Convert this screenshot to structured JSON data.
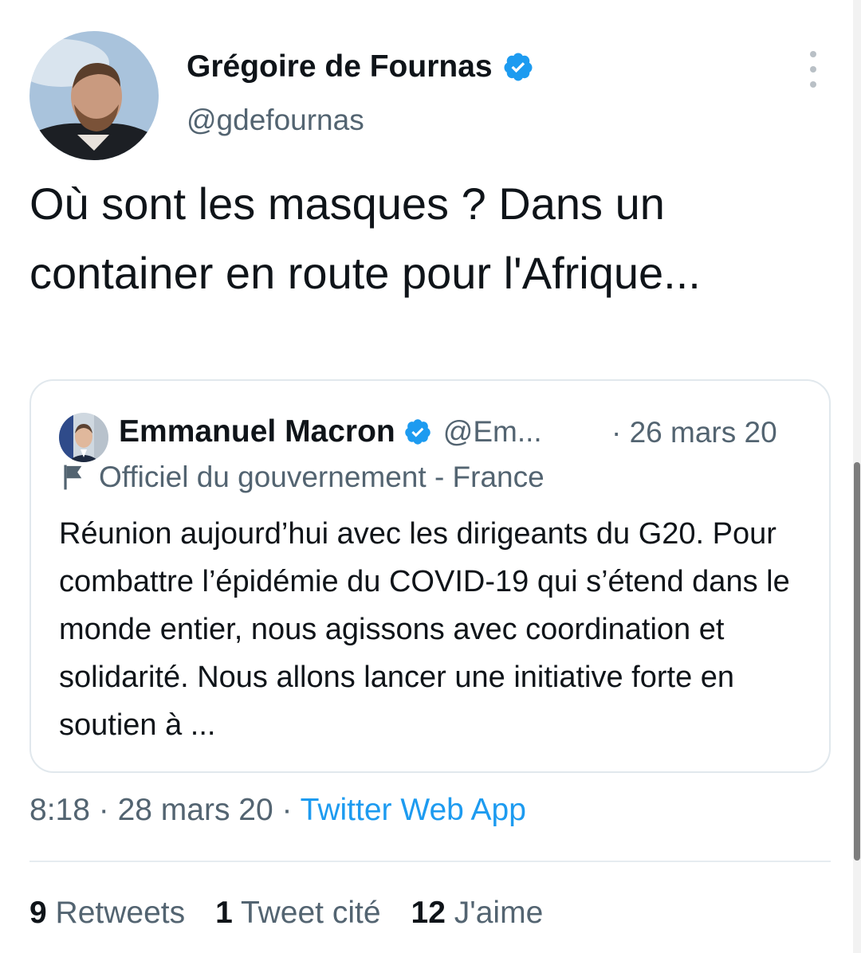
{
  "author": {
    "name": "Grégoire de Fournas",
    "handle": "@gdefournas"
  },
  "tweet": {
    "text": "Où sont les masques ? Dans un container en route pour l'Afrique..."
  },
  "quoted_tweet": {
    "author_name": "Emmanuel Macron",
    "author_handle": "@Em...",
    "date": "· 26 mars 20",
    "label": "Officiel du gouvernement - France",
    "text": "Réunion aujourd’hui avec les dirigeants du G20. Pour combattre l’épidémie du COVID-19 qui s’étend dans le monde entier, nous agissons avec coordination et solidarité. Nous allons lancer une initiative forte en soutien à ..."
  },
  "meta": {
    "time": "8:18",
    "sep1": " · ",
    "date": "28 mars 20",
    "sep2": " · ",
    "app": "Twitter Web App"
  },
  "stats": {
    "retweets_count": "9",
    "retweets_label": "Retweets",
    "quotes_count": "1",
    "quotes_label": "Tweet cité",
    "likes_count": "12",
    "likes_label": "J'aime"
  },
  "colors": {
    "verified": "#1d9bf0",
    "link": "#1d9bf0",
    "secondary_text": "#536471",
    "primary_text": "#0f1419"
  },
  "icons": [
    "verified-badge-icon",
    "more-options-icon",
    "flag-icon"
  ]
}
